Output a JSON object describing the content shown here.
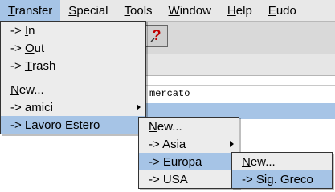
{
  "menubar": [
    {
      "label": "Transfer",
      "active": true
    },
    {
      "label": "Special",
      "active": false
    },
    {
      "label": "Tools",
      "active": false
    },
    {
      "label": "Window",
      "active": false
    },
    {
      "label": "Help",
      "active": false
    },
    {
      "label": "Eudo",
      "active": false
    }
  ],
  "transfer_menu": {
    "in": {
      "prefix": "-> ",
      "key": "I",
      "rest": "n"
    },
    "out": {
      "prefix": "-> ",
      "key": "O",
      "rest": "ut"
    },
    "trash": {
      "prefix": "-> ",
      "key": "T",
      "rest": "rash"
    },
    "new": {
      "key": "N",
      "rest": "ew..."
    },
    "amici": "-> amici",
    "lavoro_estero": "-> Lavoro Estero"
  },
  "lavoro_menu": {
    "new": {
      "key": "N",
      "rest": "ew..."
    },
    "asia": "-> Asia",
    "europa": "-> Europa",
    "usa": "-> USA"
  },
  "europa_menu": {
    "new": {
      "key": "N",
      "rest": "ew..."
    },
    "sig_greco": "-> Sig. Greco"
  },
  "background": {
    "text_line": "mercato",
    "help_icon": "question-mark-icon"
  },
  "colors": {
    "highlight": "#a6c4e6",
    "menu_bg": "#ececec",
    "help_icon": "#c00000"
  }
}
